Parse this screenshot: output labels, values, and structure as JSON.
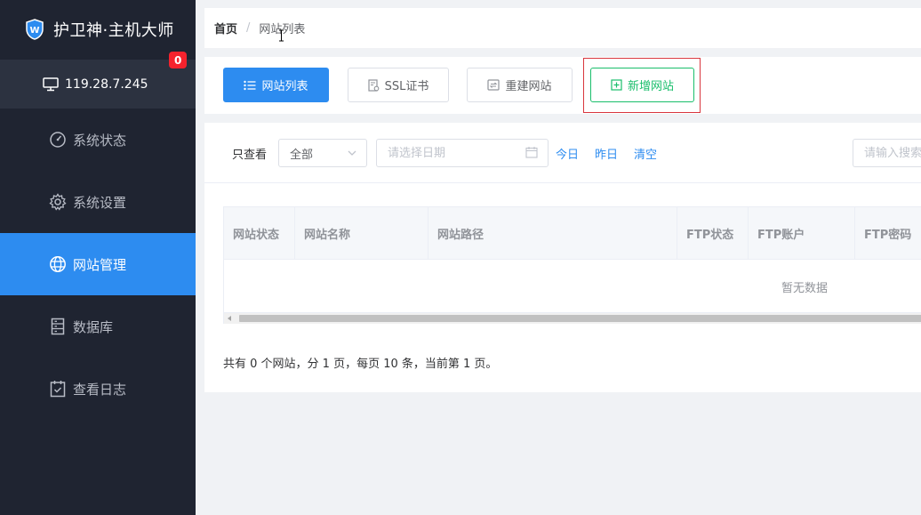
{
  "app": {
    "title": "护卫神·主机大师"
  },
  "server": {
    "ip": "119.28.7.245",
    "badge_count": "0"
  },
  "sidebar": {
    "items": [
      {
        "label": "系统状态",
        "icon": "dashboard-icon",
        "active": false
      },
      {
        "label": "系统设置",
        "icon": "gear-icon",
        "active": false
      },
      {
        "label": "网站管理",
        "icon": "globe-icon",
        "active": true
      },
      {
        "label": "数据库",
        "icon": "database-icon",
        "active": false
      },
      {
        "label": "查看日志",
        "icon": "log-icon",
        "active": false
      }
    ]
  },
  "breadcrumb": {
    "home": "首页",
    "separator": "/",
    "current": "网站列表"
  },
  "toolbar": {
    "site_list": "网站列表",
    "ssl": "SSL证书",
    "rebuild": "重建网站",
    "add_site": "新增网站"
  },
  "filter": {
    "label": "只查看",
    "select_value": "全部",
    "date_placeholder": "请选择日期",
    "today": "今日",
    "yesterday": "昨日",
    "clear": "清空",
    "search_placeholder": "请输入搜索"
  },
  "table": {
    "columns": [
      "网站状态",
      "网站名称",
      "网站路径",
      "FTP状态",
      "FTP账户",
      "FTP密码"
    ],
    "empty_text": "暂无数据"
  },
  "pager": {
    "info": "共有 0 个网站，分 1 页，每页 10 条，当前第 1 页。"
  },
  "colors": {
    "primary": "#2d8cf0",
    "success": "#19be6b",
    "sidebar_bg": "#1f2431",
    "danger": "#f5222d"
  }
}
